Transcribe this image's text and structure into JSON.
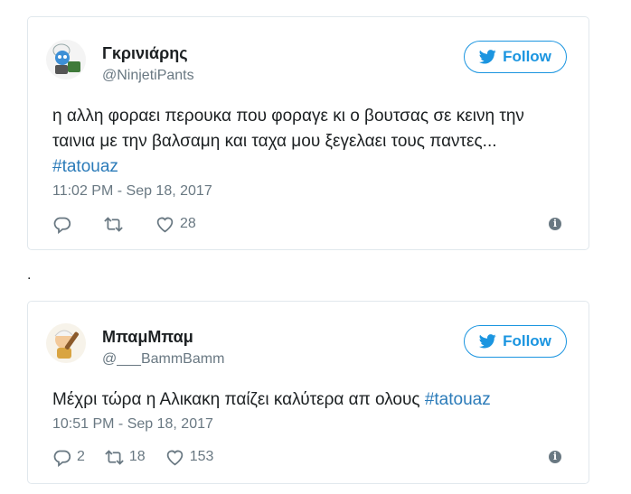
{
  "tweets": [
    {
      "display_name": "Γκρινιάρης",
      "handle": "@NinjetiPants",
      "follow_label": "Follow",
      "text": "η αλλη φοραει περουκα που φοραγε κι ο βουτσας σε κεινη την ταινια με την βαλσαμη και ταχα μου ξεγελαει τους παντες... ",
      "hashtag": "#tatouaz",
      "timestamp": "11:02 PM - Sep 18, 2017",
      "reply_count": "",
      "retweet_count": "",
      "like_count": "28",
      "avatar_icon": "smurf-avatar"
    },
    {
      "display_name": "ΜπαμΜπαμ",
      "handle": "@___BammBamm",
      "follow_label": "Follow",
      "text": "Μέχρι τώρα η Αλικακη παίζει καλύτερα απ ολους ",
      "hashtag": "#tatouaz",
      "timestamp": "10:51 PM - Sep 18, 2017",
      "reply_count": "2",
      "retweet_count": "18",
      "like_count": "153",
      "avatar_icon": "bammbamm-avatar"
    }
  ],
  "separator": ".",
  "colors": {
    "brand": "#1b95e0",
    "hashtag": "#2b7bb9",
    "muted": "#697882",
    "border": "#e1e8ed"
  }
}
